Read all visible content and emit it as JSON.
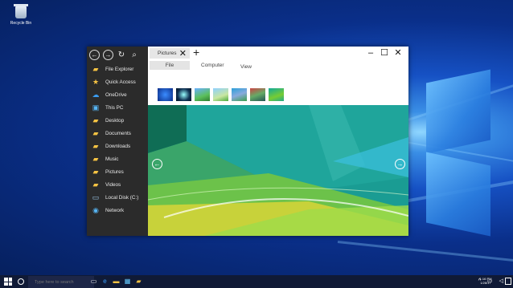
{
  "desktop": {
    "recycle_bin_label": "Recycle Bin"
  },
  "window": {
    "nav": {
      "back_icon": "back-arrow-icon",
      "forward_icon": "forward-arrow-icon",
      "refresh_icon": "refresh-icon",
      "search_icon": "search-icon"
    },
    "sidebar_items": [
      {
        "label": "File Explorer",
        "icon": "folder-icon",
        "color": "#f6c343"
      },
      {
        "label": "Quick Access",
        "icon": "star-icon",
        "color": "#f6c343"
      },
      {
        "label": "OneDrive",
        "icon": "cloud-icon",
        "color": "#3b9cf0"
      },
      {
        "label": "This PC",
        "icon": "computer-icon",
        "color": "#56b4f3"
      },
      {
        "label": "Desktop",
        "icon": "desktop-folder-icon",
        "color": "#f6c343"
      },
      {
        "label": "Documents",
        "icon": "documents-folder-icon",
        "color": "#f6c343"
      },
      {
        "label": "Downloads",
        "icon": "downloads-folder-icon",
        "color": "#f6c343"
      },
      {
        "label": "Music",
        "icon": "music-folder-icon",
        "color": "#f6c343"
      },
      {
        "label": "Pictures",
        "icon": "pictures-folder-icon",
        "color": "#f6c343"
      },
      {
        "label": "Videos",
        "icon": "videos-folder-icon",
        "color": "#f6c343"
      },
      {
        "label": "Local Disk (C:)",
        "icon": "drive-icon",
        "color": "#9cc7e8"
      },
      {
        "label": "Network",
        "icon": "network-icon",
        "color": "#56b4f3"
      }
    ],
    "tab_label": "Pictures",
    "ribbon_tabs": [
      "File",
      "Computer",
      "View"
    ]
  },
  "taskbar": {
    "search_placeholder": "Type here to search",
    "clock_time": "1:16 PM",
    "clock_date": "1/28/17"
  }
}
